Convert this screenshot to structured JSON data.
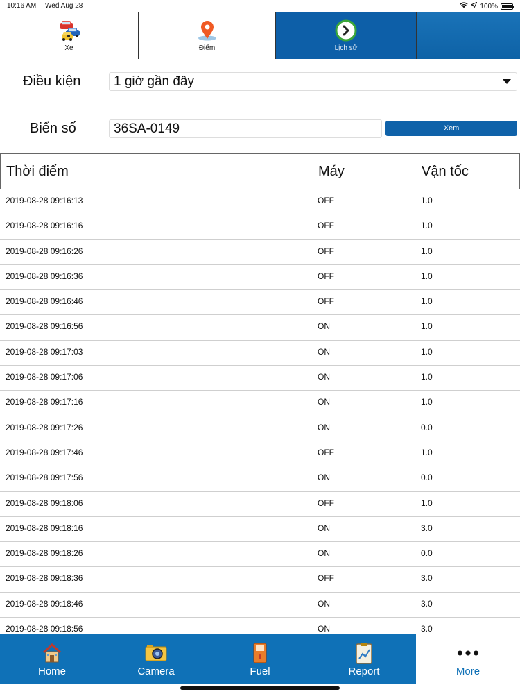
{
  "status_bar": {
    "time": "10:16 AM",
    "date": "Wed Aug 28",
    "battery": "100%"
  },
  "top_tabs": [
    {
      "label": "Xe",
      "icon": "cars-icon"
    },
    {
      "label": "Điểm",
      "icon": "map-pin-icon"
    },
    {
      "label": "Lịch sử",
      "icon": "history-clock-icon",
      "active": true
    },
    {
      "label": "",
      "icon": ""
    }
  ],
  "form": {
    "condition_label": "Điều kiện",
    "condition_value": "1 giờ gần đây",
    "plate_label": "Biển số",
    "plate_value": "36SA-0149",
    "view_button": "Xem"
  },
  "table": {
    "columns": [
      "Thời điểm",
      "Máy",
      "Vận tốc"
    ],
    "rows": [
      [
        "2019-08-28 09:16:13",
        "OFF",
        "1.0"
      ],
      [
        "2019-08-28 09:16:16",
        "OFF",
        "1.0"
      ],
      [
        "2019-08-28 09:16:26",
        "OFF",
        "1.0"
      ],
      [
        "2019-08-28 09:16:36",
        "OFF",
        "1.0"
      ],
      [
        "2019-08-28 09:16:46",
        "OFF",
        "1.0"
      ],
      [
        "2019-08-28 09:16:56",
        "ON",
        "1.0"
      ],
      [
        "2019-08-28 09:17:03",
        "ON",
        "1.0"
      ],
      [
        "2019-08-28 09:17:06",
        "ON",
        "1.0"
      ],
      [
        "2019-08-28 09:17:16",
        "ON",
        "1.0"
      ],
      [
        "2019-08-28 09:17:26",
        "ON",
        "0.0"
      ],
      [
        "2019-08-28 09:17:46",
        "OFF",
        "1.0"
      ],
      [
        "2019-08-28 09:17:56",
        "ON",
        "0.0"
      ],
      [
        "2019-08-28 09:18:06",
        "OFF",
        "1.0"
      ],
      [
        "2019-08-28 09:18:16",
        "ON",
        "3.0"
      ],
      [
        "2019-08-28 09:18:26",
        "ON",
        "0.0"
      ],
      [
        "2019-08-28 09:18:36",
        "OFF",
        "3.0"
      ],
      [
        "2019-08-28 09:18:46",
        "ON",
        "3.0"
      ],
      [
        "2019-08-28 09:18:56",
        "ON",
        "3.0"
      ]
    ]
  },
  "bottom_tabs": [
    {
      "label": "Home",
      "icon": "house-icon"
    },
    {
      "label": "Camera",
      "icon": "camera-icon"
    },
    {
      "label": "Fuel",
      "icon": "fuel-pump-icon"
    },
    {
      "label": "Report",
      "icon": "report-clipboard-icon"
    },
    {
      "label": "More",
      "icon": "more-dots-icon",
      "active": true
    }
  ],
  "colors": {
    "primary_blue": "#0f71b7",
    "active_tab_blue": "#0d5fa8",
    "view_button_blue": "#0f62a9"
  }
}
